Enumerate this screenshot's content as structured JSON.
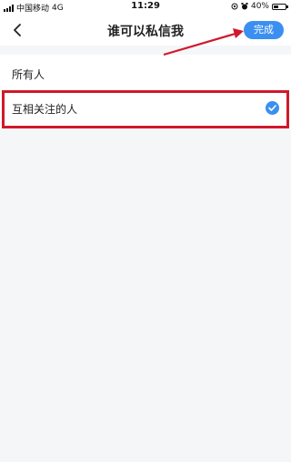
{
  "status_bar": {
    "carrier": "中国移动",
    "network": "4G",
    "time": "11:29",
    "battery": "40%",
    "battery_level": 0.4
  },
  "nav": {
    "title": "谁可以私信我",
    "done_label": "完成",
    "back_icon": "chevron-left-icon"
  },
  "options": [
    {
      "label": "所有人",
      "selected": false
    },
    {
      "label": "互相关注的人",
      "selected": true
    }
  ],
  "colors": {
    "accent": "#3a8ff0",
    "highlight": "#d0192b",
    "background": "#f5f6f8"
  }
}
